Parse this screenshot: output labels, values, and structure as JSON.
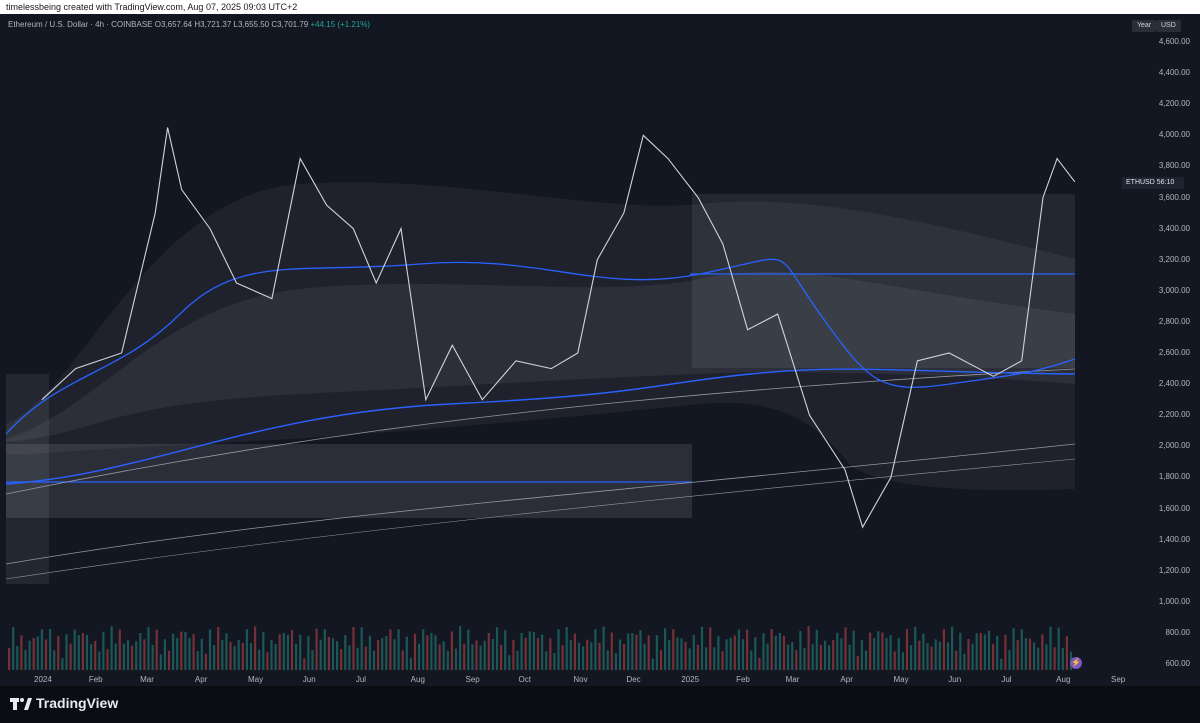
{
  "header": {
    "caption": "timelessbeing created with TradingView.com, Aug 07, 2025 09:03 UTC+2"
  },
  "legend": {
    "symbol": "Ethereum / U.S. Dollar · 4h · COINBASE",
    "open_label": "O",
    "open": "3,657.64",
    "high_label": "H",
    "high": "3,721.37",
    "low_label": "L",
    "low": "3,655.50",
    "close_label": "C",
    "close": "3,701.79",
    "change": "+44.15 (+1.21%)"
  },
  "toolbar": {
    "year_button": "Year",
    "currency_button": "USD"
  },
  "price_label": {
    "symbol": "ETHUSD",
    "countdown": "56:10"
  },
  "alert_icon_glyph": "⚡",
  "footer": {
    "brand": "TradingView"
  },
  "colors": {
    "background": "#131722",
    "ma_blue": "#2962ff",
    "candle": "#d1d4dc",
    "up_volume": "#26a69a",
    "down_volume": "#ef5350"
  },
  "chart_data": {
    "type": "line",
    "ylim": [
      600,
      4600
    ],
    "y_ticks": [
      "4,600.00",
      "4,400.00",
      "4,200.00",
      "4,000.00",
      "3,800.00",
      "3,600.00",
      "3,400.00",
      "3,200.00",
      "3,000.00",
      "2,800.00",
      "2,600.00",
      "2,400.00",
      "2,200.00",
      "2,000.00",
      "1,800.00",
      "1,600.00",
      "1,400.00",
      "1,200.00",
      "1,000.00",
      "800.00",
      "600.00"
    ],
    "x_ticks": [
      "2024",
      "Feb",
      "Mar",
      "Apr",
      "May",
      "Jun",
      "Jul",
      "Aug",
      "Sep",
      "Oct",
      "Nov",
      "Dec",
      "2025",
      "Feb",
      "Mar",
      "Apr",
      "May",
      "Jun",
      "Jul",
      "Aug",
      "Sep"
    ],
    "series": [
      {
        "x": [
          "2024-01-01",
          "2024-01-20",
          "2024-02-15",
          "2024-03-05",
          "2024-03-12",
          "2024-03-20",
          "2024-04-05",
          "2024-04-20",
          "2024-05-10",
          "2024-05-26",
          "2024-06-10",
          "2024-06-25",
          "2024-07-08",
          "2024-07-22",
          "2024-08-05",
          "2024-08-20",
          "2024-09-06",
          "2024-09-25",
          "2024-10-15",
          "2024-10-30",
          "2024-11-10",
          "2024-11-25",
          "2024-12-06",
          "2024-12-20",
          "2025-01-06",
          "2025-01-20",
          "2025-02-03",
          "2025-02-20",
          "2025-03-10",
          "2025-03-30",
          "2025-04-09",
          "2025-04-25",
          "2025-05-10",
          "2025-05-28",
          "2025-06-22",
          "2025-07-08",
          "2025-07-20",
          "2025-07-28",
          "2025-08-07"
        ],
        "values": [
          2300,
          2500,
          2600,
          3500,
          4050,
          3650,
          3400,
          3050,
          2950,
          3850,
          3550,
          3400,
          3050,
          3400,
          2300,
          2650,
          2300,
          2550,
          2500,
          2600,
          3200,
          3500,
          4000,
          3850,
          3600,
          3300,
          2750,
          2850,
          2200,
          1850,
          1480,
          1800,
          2550,
          2600,
          2450,
          2550,
          3600,
          3850,
          3701
        ]
      }
    ]
  }
}
